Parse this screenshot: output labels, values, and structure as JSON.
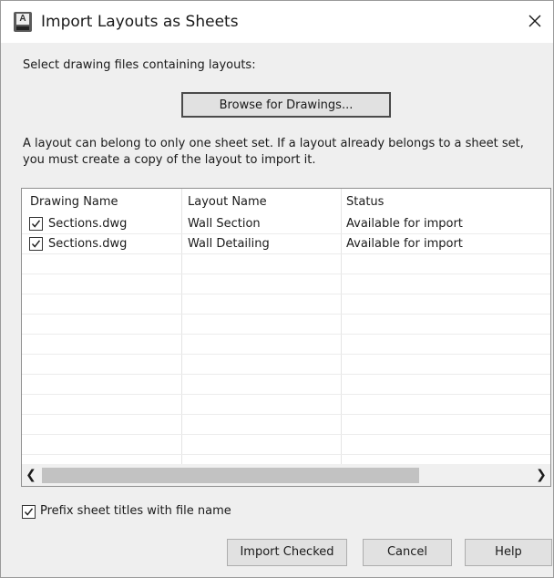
{
  "window": {
    "title": "Import Layouts as Sheets",
    "app_icon": "autocad-app-icon",
    "app_icon_letter": "A",
    "close_icon": "close-icon"
  },
  "intro_text": "Select drawing files containing layouts:",
  "browse_button": "Browse for Drawings...",
  "note_text": "A layout can belong to only one sheet set. If a layout already belongs to a sheet set, you must create a copy of the layout to import it.",
  "table": {
    "columns": [
      "Drawing Name",
      "Layout Name",
      "Status"
    ],
    "rows": [
      {
        "checked": true,
        "drawing": "Sections.dwg",
        "layout": "Wall Section",
        "status": "Available for import"
      },
      {
        "checked": true,
        "drawing": "Sections.dwg",
        "layout": "Wall Detailing",
        "status": "Available for import"
      }
    ],
    "scroll_left_icon": "chevron-left-icon",
    "scroll_right_icon": "chevron-right-icon"
  },
  "prefix_option": {
    "checked": true,
    "label": "Prefix sheet titles with file name"
  },
  "buttons": {
    "import": "Import Checked",
    "cancel": "Cancel",
    "help": "Help"
  }
}
